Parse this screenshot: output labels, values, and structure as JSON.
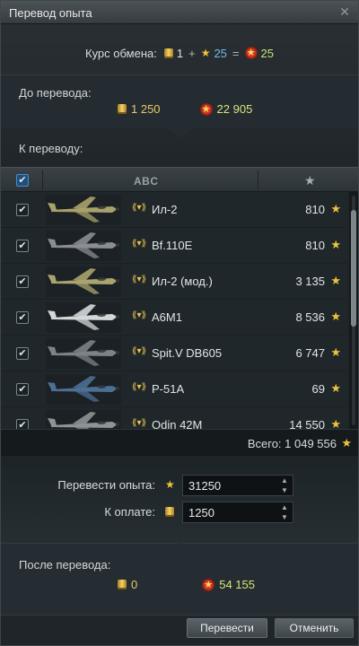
{
  "window": {
    "title": "Перевод опыта",
    "close_icon": "close-icon"
  },
  "exchange_rate": {
    "label": "Курс обмена:",
    "gold_amount": "1",
    "plus": "+",
    "combat_xp": "25",
    "equals": "=",
    "free_xp": "25"
  },
  "before_transfer": {
    "label": "До перевода:",
    "gold": "1 250",
    "free_xp": "22 905"
  },
  "to_transfer": {
    "label": "К переводу:",
    "columns": {
      "name_header": "ABC",
      "xp_header_icon": "star-icon"
    },
    "rows": [
      {
        "name": "Ил-2",
        "xp": "810",
        "plane_color": "#a8a26a",
        "tier_icon": "tier-badge-icon"
      },
      {
        "name": "Bf.110E",
        "xp": "810",
        "plane_color": "#8a8e92",
        "tier_icon": "tier-badge-icon"
      },
      {
        "name": "Ил-2 (мод.)",
        "xp": "3 135",
        "plane_color": "#a9a46d",
        "tier_icon": "tier-badge-icon"
      },
      {
        "name": "A6M1",
        "xp": "8 536",
        "plane_color": "#d4d7d8",
        "tier_icon": "tier-badge-icon"
      },
      {
        "name": "Spit.V DB605",
        "xp": "6 747",
        "plane_color": "#7c8388",
        "tier_icon": "tier-badge-icon"
      },
      {
        "name": "P-51A",
        "xp": "69",
        "plane_color": "#4d6f93",
        "tier_icon": "tier-badge-icon"
      },
      {
        "name": "Odin 42M",
        "xp": "14 550",
        "plane_color": "#8e9396",
        "tier_icon": "tier-badge-icon"
      }
    ],
    "total_label": "Всего: 1 049 556"
  },
  "form": {
    "transfer_label": "Перевести опыта:",
    "transfer_value": "31250",
    "pay_label": "К оплате:",
    "pay_value": "1250"
  },
  "after_transfer": {
    "label": "После перевода:",
    "gold": "0",
    "free_xp": "54 155"
  },
  "buttons": {
    "transfer": "Перевести",
    "cancel": "Отменить"
  },
  "colors": {
    "accent_blue": "#77b8e8",
    "free_xp_green": "#d6e47c",
    "gold": "#e8c86a",
    "star_yellow": "#f0c23c"
  }
}
